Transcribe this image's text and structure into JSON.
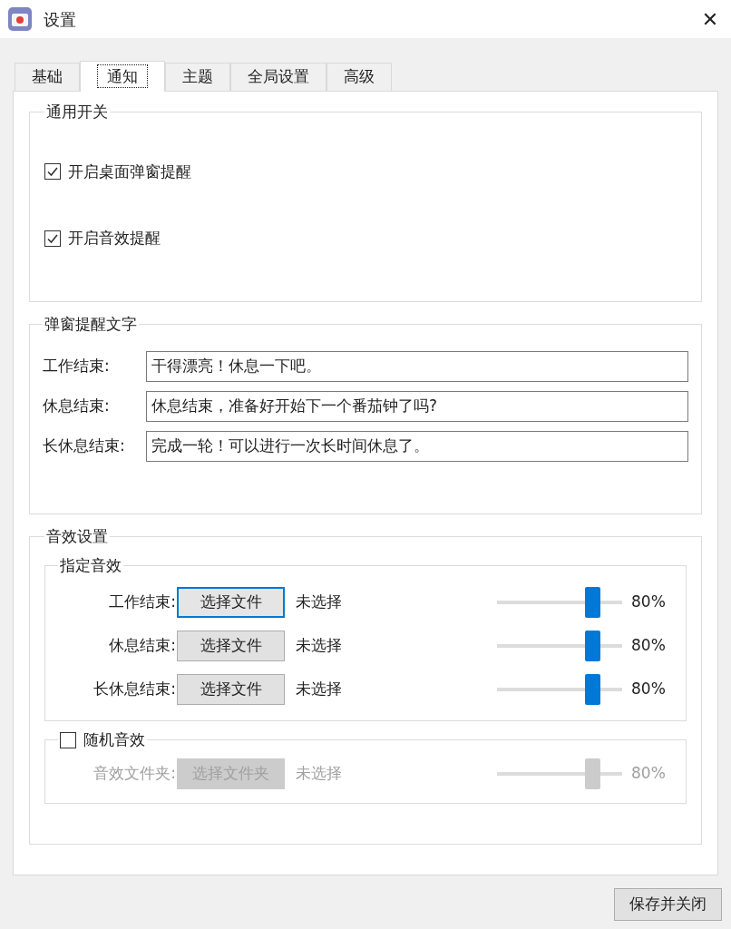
{
  "window": {
    "title": "设置",
    "close": "✕"
  },
  "tabs": [
    {
      "label": "基础",
      "selected": false
    },
    {
      "label": "通知",
      "selected": true
    },
    {
      "label": "主题",
      "selected": false
    },
    {
      "label": "全局设置",
      "selected": false
    },
    {
      "label": "高级",
      "selected": false
    }
  ],
  "general_switches": {
    "title": "通用开关",
    "options": [
      {
        "label": "开启桌面弹窗提醒",
        "checked": true
      },
      {
        "label": "开启音效提醒",
        "checked": true
      }
    ]
  },
  "popup_text": {
    "title": "弹窗提醒文字",
    "fields": [
      {
        "label": "工作结束:",
        "value": "干得漂亮！休息一下吧。"
      },
      {
        "label": "休息结束:",
        "value": "休息结束，准备好开始下一个番茄钟了吗?"
      },
      {
        "label": "长休息结束:",
        "value": "完成一轮！可以进行一次长时间休息了。"
      }
    ]
  },
  "sound_settings": {
    "title": "音效设置",
    "assigned": {
      "title": "指定音效",
      "rows": [
        {
          "label": "工作结束:",
          "button": "选择文件",
          "focused": true,
          "status": "未选择",
          "level": 0.8,
          "reading": "80%",
          "disabled": false
        },
        {
          "label": "休息结束:",
          "button": "选择文件",
          "focused": false,
          "status": "未选择",
          "level": 0.8,
          "reading": "80%",
          "disabled": false
        },
        {
          "label": "长休息结束:",
          "button": "选择文件",
          "focused": false,
          "status": "未选择",
          "level": 0.8,
          "reading": "80%",
          "disabled": false
        }
      ]
    },
    "random": {
      "label": "随机音效",
      "checked": false,
      "row": {
        "label": "音效文件夹:",
        "button": "选择文件夹",
        "focused": false,
        "status": "未选择",
        "level": 0.8,
        "reading": "80%",
        "disabled": true
      }
    }
  },
  "footer": {
    "save_button": "保存并关闭"
  }
}
